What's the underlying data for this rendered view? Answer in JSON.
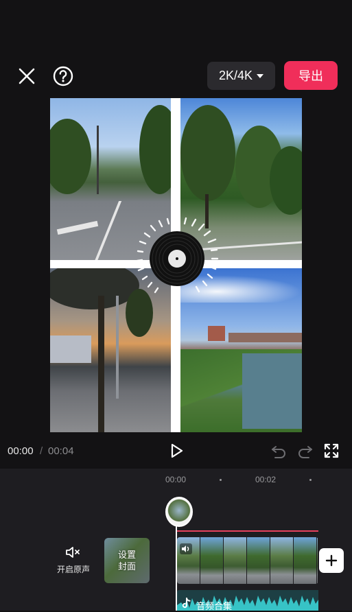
{
  "topbar": {
    "close_icon": "close-icon",
    "help_icon": "help-icon",
    "resolution_label": "2K/4K",
    "export_label": "导出",
    "accent_color": "#f02e5a"
  },
  "player": {
    "current_time": "00:00",
    "separator": "/",
    "total_time": "00:04",
    "icons": [
      "play-icon",
      "undo-icon",
      "redo-icon",
      "fullscreen-icon"
    ]
  },
  "timeline": {
    "ruler": [
      "00:00",
      "00:02"
    ],
    "mute_label": "开启原声",
    "cover_label_line1": "设置",
    "cover_label_line2": "封面",
    "audio_label": "音频合集",
    "add_icon": "plus-icon"
  }
}
